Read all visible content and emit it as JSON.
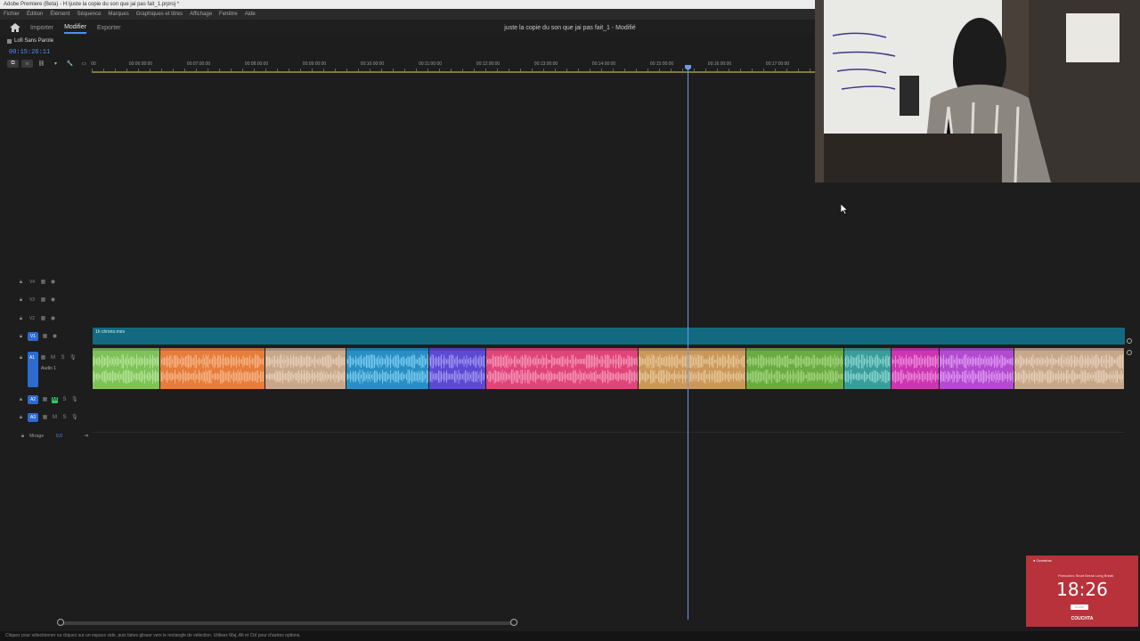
{
  "window": {
    "title": "Adobe Premiere (Beta) - H:\\juste la copie du son que jai pas fait_1.prproj *"
  },
  "menu": [
    "Fichier",
    "Édition",
    "Élément",
    "Séquence",
    "Marques",
    "Graphiques et titres",
    "Affichage",
    "Fenêtre",
    "Aide"
  ],
  "workspace": {
    "tabs": [
      {
        "label": "Importer",
        "active": false
      },
      {
        "label": "Modifier",
        "active": true
      },
      {
        "label": "Exporter",
        "active": false
      }
    ],
    "document_title": "juste la copie du son que jai pas fait_1 - Modifié"
  },
  "sequence": {
    "name": "Lofi Sans Parole",
    "timecode": "00:15:26:11"
  },
  "ruler": {
    "ticks": [
      "00",
      "00:06:00:00",
      "00:07:00:00",
      "00:08:00:00",
      "00:09:00:00",
      "00:10:00:00",
      "00:11:00:00",
      "00:12:00:00",
      "00:13:00:00",
      "00:14:00:00",
      "00:15:00:00",
      "00:16:00:00",
      "00:17:00:00"
    ]
  },
  "tracks": {
    "video": [
      "V4",
      "V3",
      "V2",
      "V1"
    ],
    "audio": [
      "A1",
      "A2",
      "A3"
    ],
    "a1_name": "Audio 1",
    "mix_label": "Mixage",
    "mix_value": "0,0"
  },
  "video_clip": {
    "name": "1h chrono.mov",
    "color": "#126a80"
  },
  "audio_clips": [
    {
      "color": "#7fc25a",
      "wave": "#b7e79a"
    },
    {
      "color": "#e67d3c",
      "wave": "#f6b98c"
    },
    {
      "color": "#c8a88b",
      "wave": "#ead2bd"
    },
    {
      "color": "#2a8fc0",
      "wave": "#7fd0f5"
    },
    {
      "color": "#5b4ad2",
      "wave": "#a79af3"
    },
    {
      "color": "#e0457a",
      "wave": "#f59bbb"
    },
    {
      "color": "#c9985a",
      "wave": "#ebc99b"
    },
    {
      "color": "#6aab44",
      "wave": "#a7d882"
    },
    {
      "color": "#3a9d99",
      "wave": "#8fdad6"
    },
    {
      "color": "#cc36b0",
      "wave": "#ef8edf"
    },
    {
      "color": "#b24bd0",
      "wave": "#e19cf4"
    },
    {
      "color": "#c8a88b",
      "wave": "#ead2bd"
    }
  ],
  "status_bar": "Cliquez pour sélectionner ou cliquez sur un espace vide, puis faites glisser vers le rectangle de sélection. Utilisez Maj, Alt et Ctrl pour d'autres options.",
  "clock_overlay": {
    "brand": "● Ocomtrac",
    "nav": "Pomodoro   Short Break   Long Break",
    "time": "18:26",
    "button": "PAUSE",
    "name": "COUCHTA"
  }
}
